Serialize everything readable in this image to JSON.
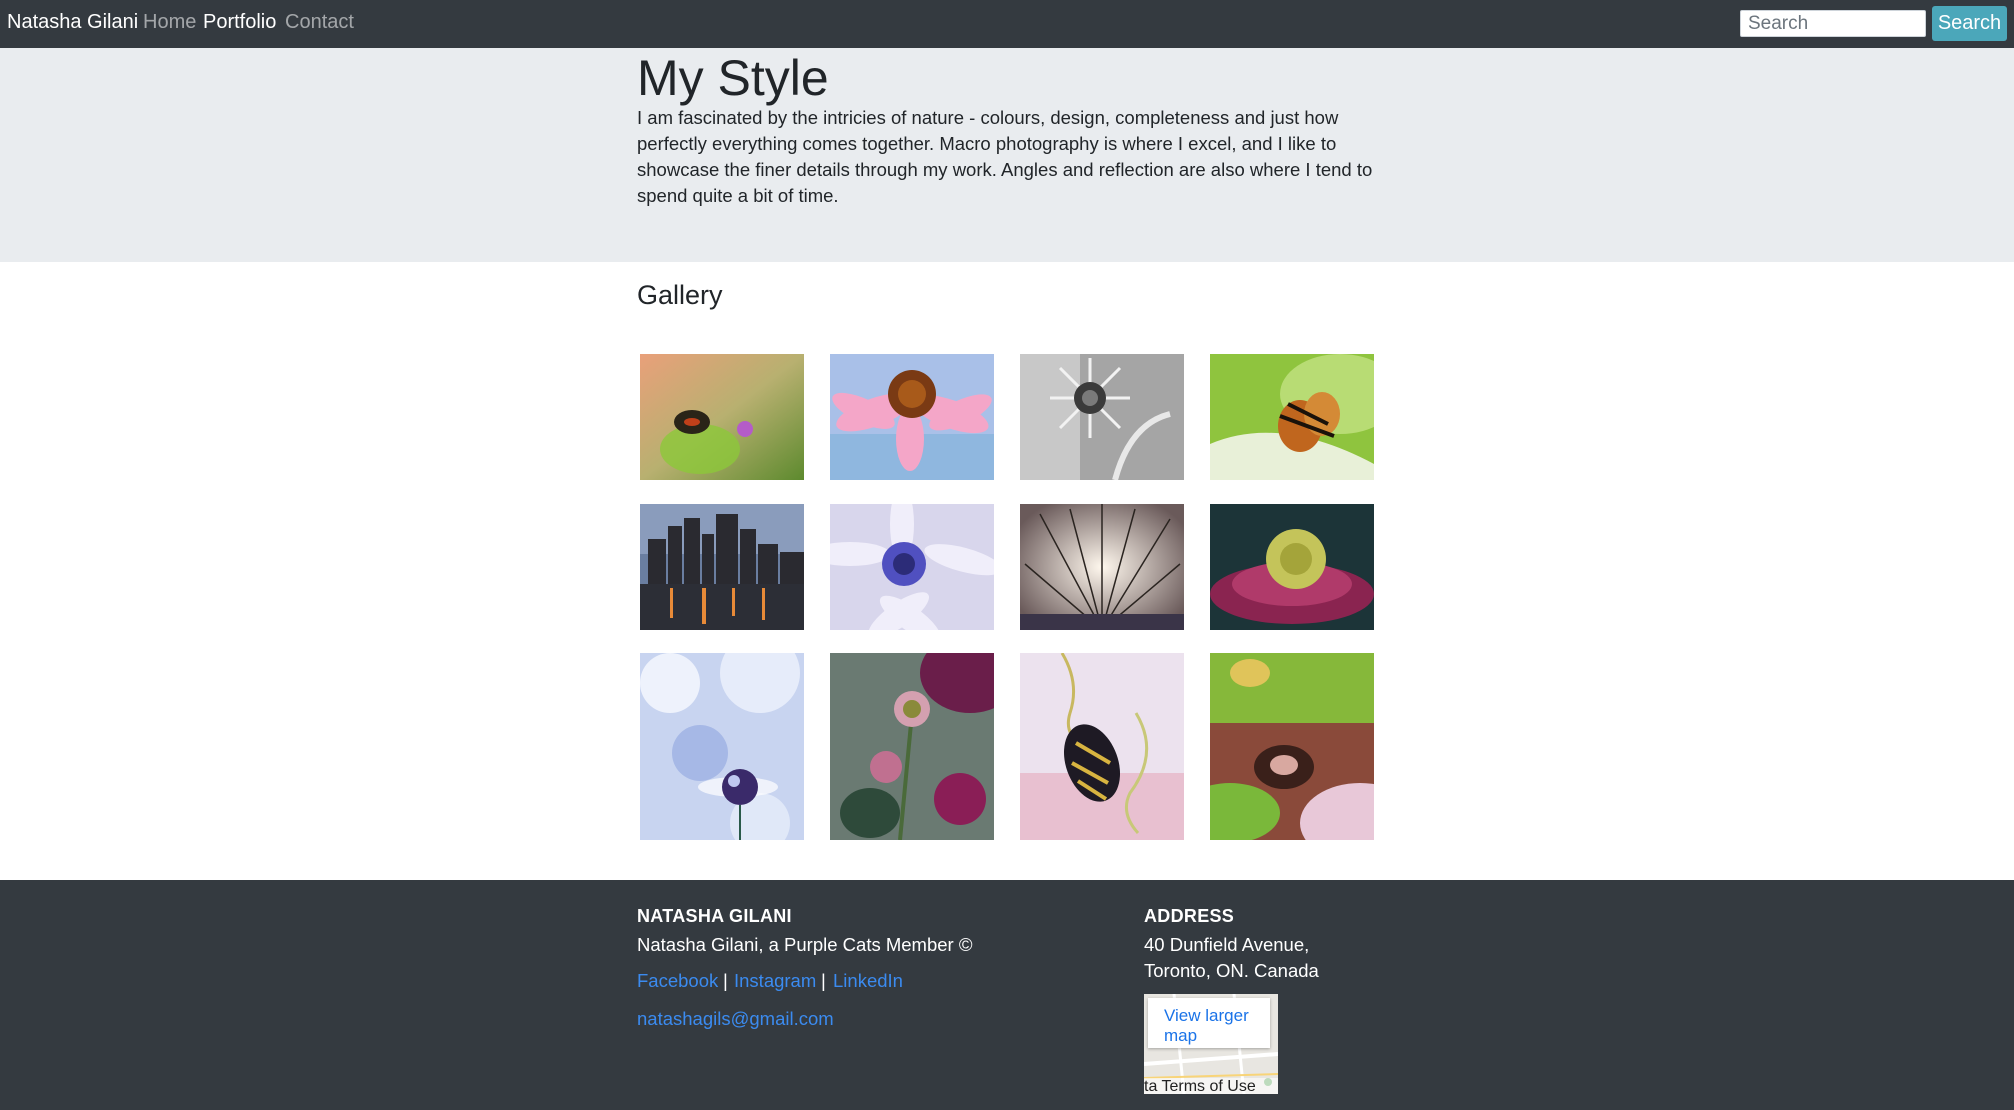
{
  "navbar": {
    "brand": "Natasha Gilani",
    "links": [
      "Home",
      "Portfolio",
      "Contact"
    ],
    "active": "Portfolio",
    "search_placeholder": "Search",
    "search_button": "Search"
  },
  "jumbotron": {
    "title": "My Style",
    "text": "I am fascinated by the intricies of nature - colours, design, completeness and just how perfectly everything comes together. Macro photography is where I excel, and I like to showcase the finer details through my work. Angles and reflection are also where I tend to spend quite a bit of time."
  },
  "gallery": {
    "title": "Gallery",
    "images": [
      "butterfly-on-flower-photo",
      "pink-coneflower-photo",
      "black-white-flower-photo",
      "butterfly-on-leaf-photo",
      "city-skyline-night-photo",
      "purple-daisy-photo",
      "dandelion-seeds-photo",
      "pink-zinnia-photo",
      "water-droplet-bokeh-photo",
      "pink-dahlias-photo",
      "butterfly-on-tendril-photo",
      "butterfly-on-pink-flower-photo"
    ]
  },
  "footer": {
    "name_heading": "NATASHA GILANI",
    "tagline": "Natasha Gilani, a Purple Cats Member ©",
    "social": [
      "Facebook",
      "Instagram",
      "LinkedIn"
    ],
    "separator": "|",
    "email": "natashagils@gmail.com",
    "address_heading": "ADDRESS",
    "address_line1": "40 Dunfield Avenue,",
    "address_line2": "Toronto, ON. Canada",
    "map_link": "View larger map",
    "map_terms": "ta  Terms of Use"
  },
  "colors": {
    "navbar_bg": "#343a40",
    "jumbotron_bg": "#e9ecef",
    "search_button_bg": "#4ba7ba",
    "link": "#3b8bf0"
  }
}
